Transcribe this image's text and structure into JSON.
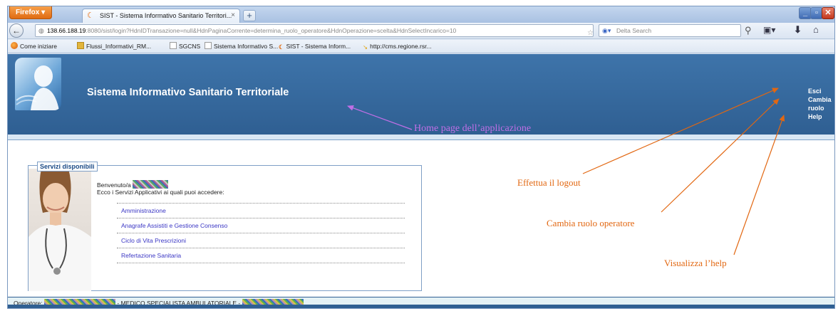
{
  "browser": {
    "firefox_button_label": "Firefox",
    "tab_title": "SIST - Sistema Informativo Sanitario Territori...",
    "tab_close": "×",
    "new_tab": "+",
    "window_controls": {
      "minimize": "_",
      "maximize": "▫",
      "close": "✕"
    },
    "url": {
      "host": "138.66.188.19",
      "rest": ":8080/sist/login?HdnIDTransazione=null&HdnPaginaCorrente=determina_ruolo_operatore&HdnOperazione=scelta&HdnSelectIncarico=10"
    },
    "search_placeholder": "Delta Search",
    "bookmarks": [
      {
        "label": "Come iniziare",
        "icon": "firefox-icon"
      },
      {
        "label": "Flussi_Informativi_RM...",
        "icon": "folder-icon"
      },
      {
        "label": "SGCNS",
        "icon": "page-icon"
      },
      {
        "label": "Sistema Informativo S...",
        "icon": "page-icon"
      },
      {
        "label": "SIST - Sistema Inform...",
        "icon": "sist-icon"
      },
      {
        "label": "http://cms.regione.rsr...",
        "icon": "link-icon"
      }
    ]
  },
  "app": {
    "title": "Sistema Informativo Sanitario Territoriale",
    "header_links": {
      "logout": "Esci",
      "change_role": "Cambia ruolo",
      "help": "Help"
    },
    "panel": {
      "title": "Servizi disponibili",
      "welcome": "Benvenuto/a",
      "subtitle": "Ecco i Servizi Applicativi ai quali puoi accedere:",
      "services": [
        "Amministrazione",
        "Anagrafe Assistiti e Gestione Consenso",
        "Ciclo di Vita Prescrizioni",
        "Refertazione Sanitaria"
      ]
    },
    "status": {
      "operator_label": "Operatore:",
      "role": "- MEDICO SPECIALISTA AMBULATORIALE -"
    }
  },
  "annotations": {
    "home": "Home page dell’applicazione",
    "logout": "Effettua il logout",
    "change_role": "Cambia ruolo operatore",
    "help": "Visualizza l’help"
  },
  "colors": {
    "header_blue": "#3e74aa",
    "annotation_purple": "#c06fe6",
    "annotation_orange": "#e26711",
    "service_link": "#3a36c4"
  }
}
